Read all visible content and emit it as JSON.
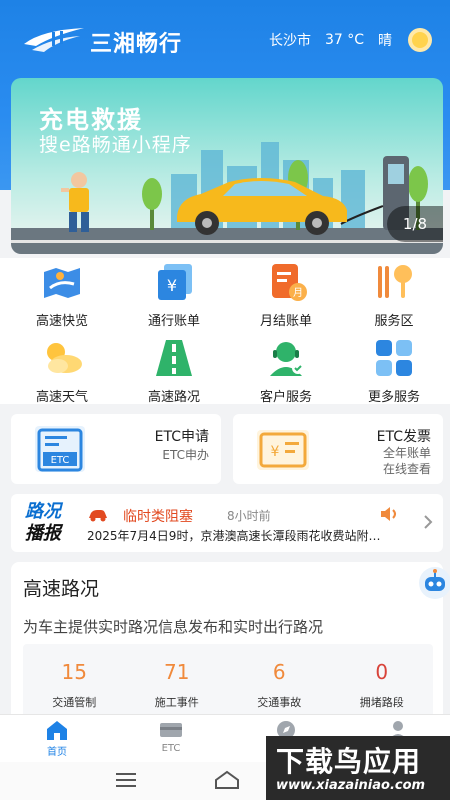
{
  "header": {
    "app_name": "三湘畅行",
    "city": "长沙市",
    "temperature": "37 °C",
    "weather": "晴",
    "weather_icon": "sun-icon"
  },
  "banner": {
    "title": "充电救援",
    "subtitle": "搜e路畅通小程序",
    "page_indicator": "1/8"
  },
  "services": [
    {
      "label": "高速快览",
      "icon": "map-icon"
    },
    {
      "label": "通行账单",
      "icon": "yuan-bill-icon"
    },
    {
      "label": "月结账单",
      "icon": "monthly-bill-icon"
    },
    {
      "label": "服务区",
      "icon": "service-area-icon"
    },
    {
      "label": "高速天气",
      "icon": "weather-icon"
    },
    {
      "label": "高速路况",
      "icon": "road-icon"
    },
    {
      "label": "客户服务",
      "icon": "customer-service-icon"
    },
    {
      "label": "更多服务",
      "icon": "more-grid-icon"
    }
  ],
  "etc_cards": [
    {
      "title": "ETC申请",
      "lines": [
        "ETC申办"
      ],
      "icon": "etc-card-icon"
    },
    {
      "title": "ETC发票",
      "lines": [
        "全年账单",
        "在线查看"
      ],
      "icon": "invoice-icon"
    }
  ],
  "news": {
    "tag_line1": "路况",
    "tag_line2": "播报",
    "category": "临时类阻塞",
    "time": "8小时前",
    "text": "2025年7月4日9时，京港澳高速长潭段雨花收费站附…"
  },
  "road": {
    "title": "高速路况",
    "description": "为车主提供实时路况信息发布和实时出行路况",
    "stats": [
      {
        "value": "15",
        "label": "交通管制"
      },
      {
        "value": "71",
        "label": "施工事件"
      },
      {
        "value": "6",
        "label": "交通事故"
      },
      {
        "value": "0",
        "label": "拥堵路段"
      }
    ]
  },
  "tabbar": {
    "tabs": [
      {
        "label": "首页",
        "active": true
      },
      {
        "label": "ETC",
        "active": false
      }
    ]
  },
  "watermark": {
    "main": "下载鸟应用",
    "url": "www.xiazainiao.com"
  },
  "colors": {
    "primary": "#1e82e6",
    "accent_orange": "#f08a3c",
    "alert_red": "#e24a21"
  }
}
